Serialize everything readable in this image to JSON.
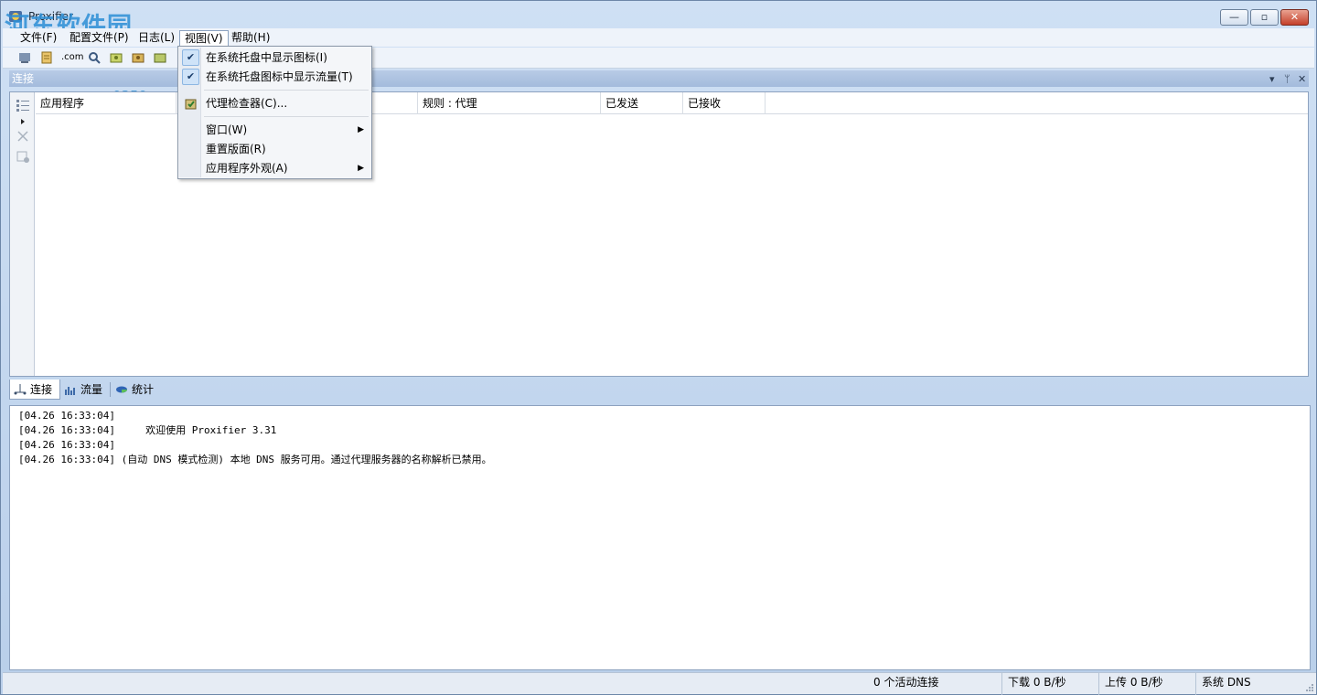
{
  "window": {
    "title": "Proxifier",
    "watermark": "河东软件园",
    "watermark_url": "www.pc0359.cn",
    "controls": {
      "minimize": "—",
      "maximize": "▫",
      "close": "✕"
    }
  },
  "menubar": {
    "items": [
      {
        "label": "文件(F)"
      },
      {
        "label": "配置文件(P)"
      },
      {
        "label": "日志(L)"
      },
      {
        "label": "视图(V)"
      },
      {
        "label": "帮助(H)"
      }
    ]
  },
  "toolbar": {
    "com_label": ".com"
  },
  "view_menu": {
    "items": [
      {
        "label": "在系统托盘中显示图标(I)",
        "checked": true
      },
      {
        "label": "在系统托盘图标中显示流量(T)",
        "checked": true
      },
      {
        "label": "代理检查器(C)..."
      },
      {
        "label": "窗口(W)",
        "submenu": true
      },
      {
        "label": "重置版面(R)"
      },
      {
        "label": "应用程序外观(A)",
        "submenu": true
      }
    ],
    "check_glyph": "✔",
    "arrow_glyph": "▶"
  },
  "connections_panel": {
    "title": "连接",
    "controls": [
      "▾",
      "ᛘ",
      "✕"
    ],
    "columns": [
      "应用程序",
      "规则 : 代理",
      "已发送",
      "已接收"
    ]
  },
  "tabs": [
    {
      "label": "连接",
      "icon": "network-icon",
      "active": true
    },
    {
      "label": "流量",
      "icon": "traffic-chart-icon"
    },
    {
      "label": "统计",
      "icon": "pie-chart-icon"
    }
  ],
  "log": {
    "lines": [
      "[04.26 16:33:04]",
      "[04.26 16:33:04]     欢迎使用 Proxifier 3.31",
      "[04.26 16:33:04]",
      "[04.26 16:33:04] (自动 DNS 模式检测) 本地 DNS 服务可用。通过代理服务器的名称解析已禁用。"
    ]
  },
  "statusbar": {
    "active_connections": "0 个活动连接",
    "download": "下载 0 B/秒",
    "upload": "上传 0 B/秒",
    "dns": "系统 DNS"
  },
  "colors": {
    "accent": "#2d8fd6",
    "panel_header": "#a3bbdc",
    "close_button": "#c4402a"
  }
}
